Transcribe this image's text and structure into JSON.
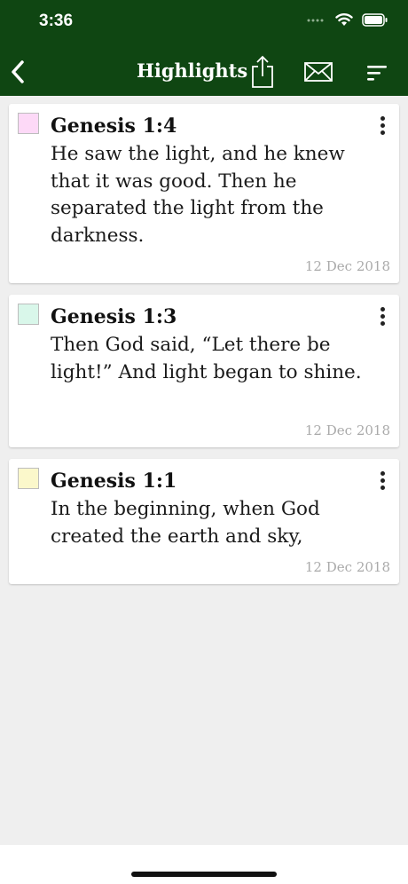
{
  "status_bar": {
    "time": "3:36"
  },
  "header": {
    "title": "Highlights",
    "icons": [
      "chevron-left-icon",
      "share-icon",
      "mail-icon",
      "sort-icon"
    ]
  },
  "highlights": [
    {
      "reference": "Genesis 1:4",
      "text": "He saw the light, and he knew that it was good. Then he separated the light from the darkness.",
      "date": "12 Dec 2018",
      "color": "#fdd9f7"
    },
    {
      "reference": "Genesis 1:3",
      "text": "Then God said, “Let there be light!” And light began to shine.",
      "date": "12 Dec 2018",
      "color": "#d9f7ea"
    },
    {
      "reference": "Genesis 1:1",
      "text": "In the beginning, when God created the earth and sky,",
      "date": "12 Dec 2018",
      "color": "#fbf8cb"
    }
  ],
  "colors": {
    "header_bg": "#0f4612",
    "page_bg": "#efefef"
  }
}
